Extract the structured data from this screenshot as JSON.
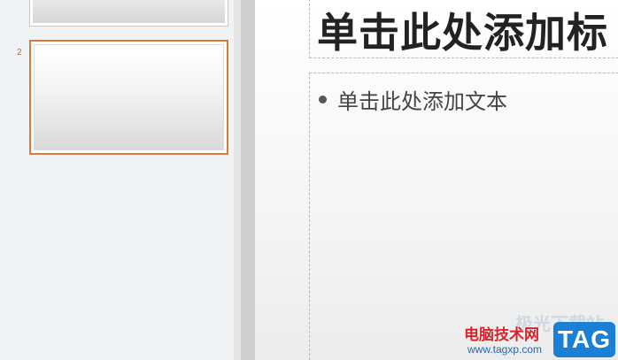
{
  "thumbnails": [
    {
      "number": ""
    },
    {
      "number": "2"
    }
  ],
  "slide": {
    "title_placeholder": "单击此处添加标",
    "body_placeholder": "单击此处添加文本"
  },
  "watermark": {
    "ghost_text": "极光下载站",
    "site_name": "电脑技术网",
    "url": "www.tagxp.com",
    "badge": "TAG"
  },
  "colors": {
    "selected_thumbnail_border": "#d77a3c",
    "watermark_red": "#d6232a",
    "watermark_blue": "#1b7fd6"
  }
}
